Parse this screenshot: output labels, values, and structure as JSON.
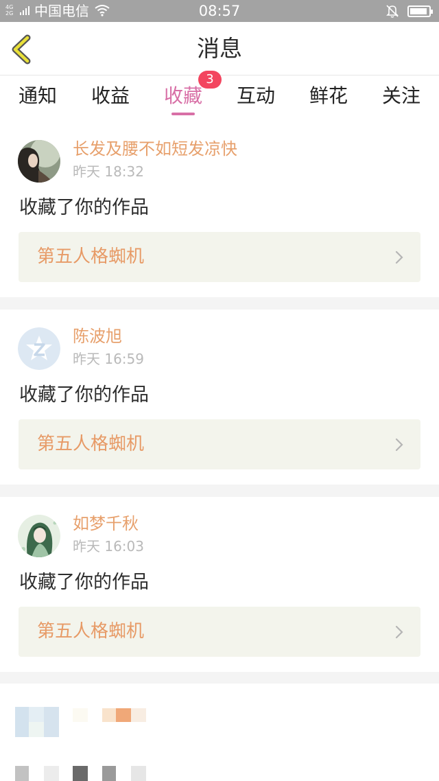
{
  "status_bar": {
    "network": "4G 2G",
    "carrier": "中国电信",
    "time": "08:57",
    "icons": [
      "signal-icon",
      "wifi-icon",
      "bell-muted-icon",
      "battery-icon"
    ]
  },
  "header": {
    "back_icon": "chevron-left-icon",
    "title": "消息"
  },
  "tabs": {
    "items": [
      {
        "label": "通知"
      },
      {
        "label": "收益"
      },
      {
        "label": "收藏"
      },
      {
        "label": "互动"
      },
      {
        "label": "鲜花"
      },
      {
        "label": "关注"
      }
    ],
    "active_index": 2,
    "badge": "3"
  },
  "notifications": [
    {
      "username": "长发及腰不如短发凉快",
      "time": "昨天 18:32",
      "action": "收藏了你的作品",
      "work_title": "第五人格蜘机"
    },
    {
      "username": "陈波旭",
      "time": "昨天 16:59",
      "action": "收藏了你的作品",
      "work_title": "第五人格蜘机"
    },
    {
      "username": "如梦千秋",
      "time": "昨天 16:03",
      "action": "收藏了你的作品",
      "work_title": "第五人格蜘机"
    }
  ],
  "colors": {
    "accent": "#d86fa6",
    "badge": "#f3455f",
    "username": "#e7a06c",
    "work_title": "#e79a66",
    "work_bg": "#f3f4ec",
    "page_bg": "#f4f4f4"
  }
}
